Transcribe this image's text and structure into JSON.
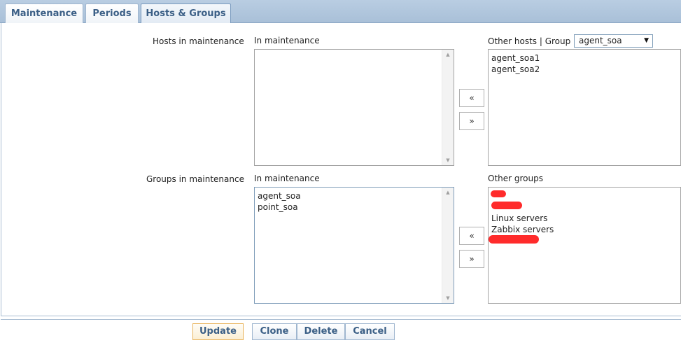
{
  "tabs": [
    {
      "label": "Maintenance"
    },
    {
      "label": "Periods"
    },
    {
      "label": "Hosts & Groups",
      "active": true
    }
  ],
  "hosts": {
    "row_label": "Hosts in maintenance",
    "in_label": "In maintenance",
    "in_items": [],
    "other_label": "Other hosts | Group",
    "group_select_value": "agent_soa",
    "other_items": [
      "agent_soa1",
      "agent_soa2"
    ]
  },
  "groups": {
    "row_label": "Groups in maintenance",
    "in_label": "In maintenance",
    "in_items": [
      "agent_soa",
      "point_soa"
    ],
    "other_label": "Other groups",
    "other_items": [
      "Linux servers",
      "Zabbix servers"
    ]
  },
  "move_buttons": {
    "left": "«",
    "right": "»"
  },
  "buttons": {
    "update": "Update",
    "clone": "Clone",
    "delete": "Delete",
    "cancel": "Cancel"
  },
  "colors": {
    "redaction": "#ff2b2b",
    "accent": "#3b5f86"
  }
}
